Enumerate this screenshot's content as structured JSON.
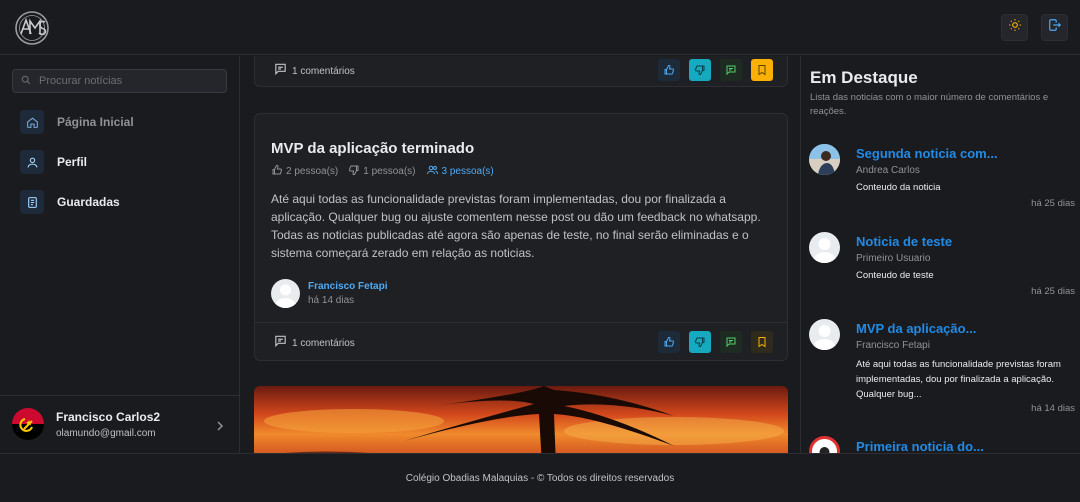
{
  "header": {
    "logo_icon": "school-seal-logo",
    "theme_icon": "sun-icon",
    "logout_icon": "logout-icon"
  },
  "sidebar": {
    "search_placeholder": "Procurar notícias",
    "items": [
      {
        "label": "Página Inicial",
        "icon": "home-icon"
      },
      {
        "label": "Perfil",
        "icon": "user-icon"
      },
      {
        "label": "Guardadas",
        "icon": "bookmark-list-icon"
      }
    ],
    "user": {
      "name": "Francisco Carlos2",
      "email": "olamundo@gmail.com"
    }
  },
  "feed": {
    "top_card": {
      "comments": "1 comentários"
    },
    "post": {
      "title": "MVP da aplicação terminado",
      "likes": "2 pessoa(s)",
      "dislikes": "1 pessoa(s)",
      "viewers": "3 pessoa(s)",
      "body": "Até aqui todas as funcionalidade previstas foram implementadas, dou por finalizada a aplicação. Qualquer bug ou ajuste comentem nesse post ou dão um feedback no whatsapp. Todas as noticias publicadas até agora são apenas de teste, no final serão eliminadas e o sistema começará zerado em relação as noticias.",
      "author": "Francisco Fetapi",
      "time": "há 14 dias",
      "comments": "1 comentários"
    }
  },
  "featured": {
    "title": "Em Destaque",
    "subtitle": "Lista das noticias com o maior número de comentários e reações.",
    "items": [
      {
        "title": "Segunda noticia com...",
        "author": "Andrea Carlos",
        "excerpt": "Conteudo da noticia",
        "time": "há 25 dias"
      },
      {
        "title": "Noticia de teste",
        "author": "Primeiro Usuario",
        "excerpt": "Conteudo de teste",
        "time": "há 25 dias"
      },
      {
        "title": "MVP da aplicação...",
        "author": "Francisco Fetapi",
        "excerpt": "Até aqui todas as funcionalidade previstas foram implementadas, dou por finalizada a aplicação. Qualquer bug...",
        "time": "há 14 dias"
      },
      {
        "title": "Primeira noticia do..."
      }
    ]
  },
  "footer": {
    "text": "Colégio Obadias Malaquias - © Todos os direitos reservados"
  },
  "colors": {
    "accent": "#228be6",
    "cyan": "#15aabf",
    "gold": "#fab005",
    "link": "#4dabf7"
  }
}
